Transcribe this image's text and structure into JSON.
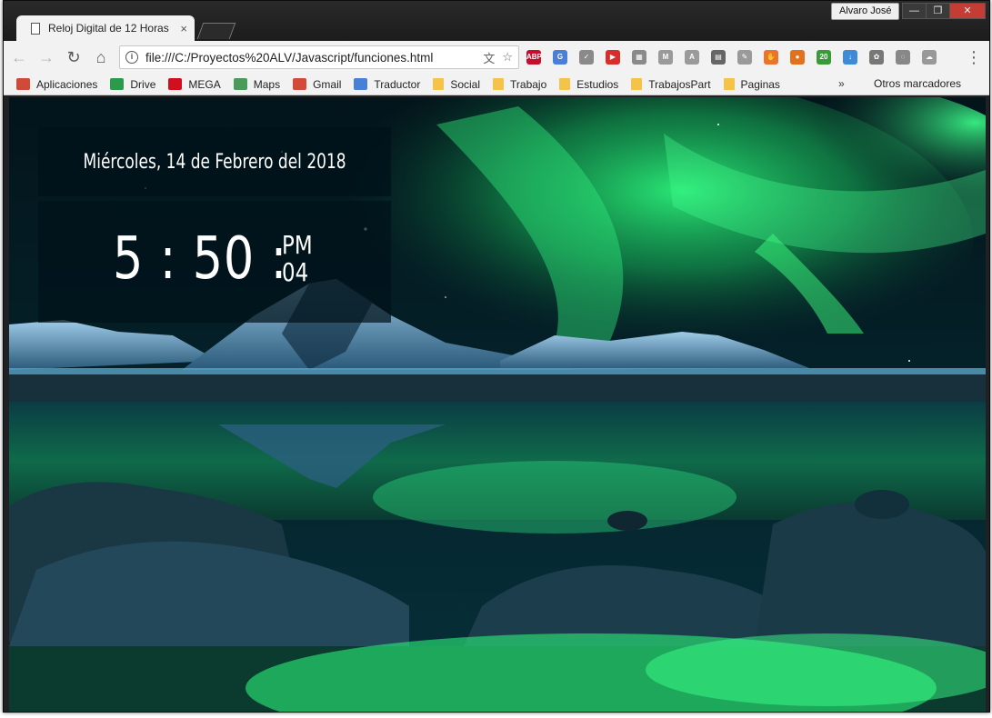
{
  "window": {
    "tab_title": "Reloj Digital de 12 Horas",
    "tab_close": "×",
    "profile_name": "Alvaro José",
    "minimize": "—",
    "maximize": "❐",
    "close": "✕"
  },
  "toolbar": {
    "back": "←",
    "forward": "→",
    "reload": "↻",
    "home": "⌂",
    "url": "file:///C:/Proyectos%20ALV/Javascript/funciones.html",
    "translate_icon": "文",
    "star_icon": "☆",
    "menu_icon": "⋮",
    "extensions": [
      {
        "name": "adblock-plus-icon",
        "label": "ABP",
        "color": "#c70d2c"
      },
      {
        "name": "google-translate-icon",
        "label": "G",
        "color": "#4a7fd8"
      },
      {
        "name": "shield-icon",
        "label": "✓",
        "color": "#8a8a8a"
      },
      {
        "name": "video-downloader-icon",
        "label": "▶",
        "color": "#d62d2d"
      },
      {
        "name": "briefcase-icon",
        "label": "▦",
        "color": "#8a8a8a"
      },
      {
        "name": "mercury-icon",
        "label": "M",
        "color": "#9a9a9a"
      },
      {
        "name": "pdf-icon",
        "label": "A",
        "color": "#9a9a9a"
      },
      {
        "name": "pdf-dark-icon",
        "label": "▤",
        "color": "#666666"
      },
      {
        "name": "wrench-icon",
        "label": "✎",
        "color": "#9a9a9a"
      },
      {
        "name": "hand-icon",
        "label": "✋",
        "color": "#e8742e"
      },
      {
        "name": "basketball-icon",
        "label": "●",
        "color": "#e0711e"
      },
      {
        "name": "recycle-icon",
        "label": "20",
        "color": "#3a9a3a"
      },
      {
        "name": "download-icon",
        "label": "↓",
        "color": "#3d8bd8"
      },
      {
        "name": "film-icon",
        "label": "✿",
        "color": "#777777"
      },
      {
        "name": "bulb-icon",
        "label": "◌",
        "color": "#888888"
      },
      {
        "name": "cloud-icon",
        "label": "☁",
        "color": "#999999"
      }
    ]
  },
  "bookmarks": {
    "items": [
      {
        "label": "Aplicaciones",
        "icon": "apps-grid-icon",
        "color": "#d04a3a"
      },
      {
        "label": "Drive",
        "icon": "drive-icon",
        "color": "#2c9a4c"
      },
      {
        "label": "MEGA",
        "icon": "mega-icon",
        "color": "#d0101e"
      },
      {
        "label": "Maps",
        "icon": "maps-icon",
        "color": "#4a9a5a"
      },
      {
        "label": "Gmail",
        "icon": "gmail-icon",
        "color": "#d44a3a"
      },
      {
        "label": "Traductor",
        "icon": "translate-icon",
        "color": "#4a7fd8"
      },
      {
        "label": "Social",
        "icon": "folder-icon",
        "color": "#f4c44a"
      },
      {
        "label": "Trabajo",
        "icon": "folder-icon",
        "color": "#f4c44a"
      },
      {
        "label": "Estudios",
        "icon": "folder-icon",
        "color": "#f4c44a"
      },
      {
        "label": "TrabajosPart",
        "icon": "folder-icon",
        "color": "#f4c44a"
      },
      {
        "label": "Paginas",
        "icon": "folder-icon",
        "color": "#f4c44a"
      }
    ],
    "more": "»",
    "other": "Otros marcadores"
  },
  "clock": {
    "date": "Miércoles, 14 de Febrero del 2018",
    "hours": "5",
    "sep1": ":",
    "minutes": "50",
    "sep2": ":",
    "ampm": "PM",
    "seconds": "04"
  },
  "colors": {
    "aurora": "#23e86a",
    "sky": "#041c24",
    "mountain_snow": "#7fb9dd",
    "water": "#0e5a4a"
  }
}
